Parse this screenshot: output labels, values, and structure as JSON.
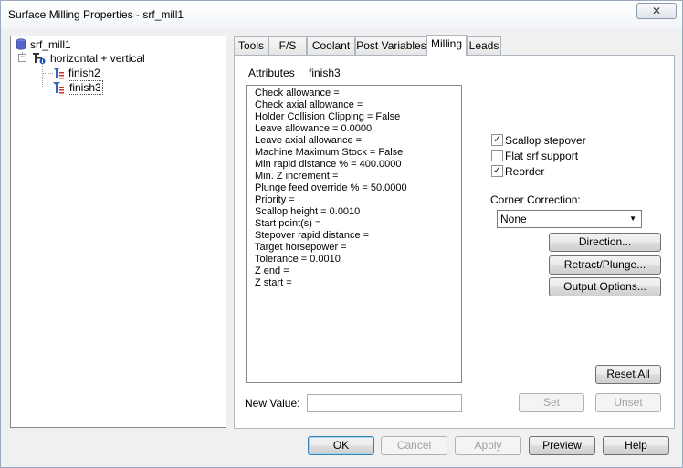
{
  "window": {
    "title": "Surface Milling Properties - srf_mill1",
    "close_label": "✕"
  },
  "tree": {
    "root": "srf_mill1",
    "group": "horizontal + vertical",
    "children": [
      "finish2",
      "finish3"
    ],
    "expander_symbol": "−"
  },
  "tabs": [
    "Tools",
    "F/S",
    "Coolant",
    "Post Variables",
    "Milling",
    "Leads"
  ],
  "active_tab": "Milling",
  "milling": {
    "attributes_label": "Attributes",
    "selected_operation": "finish3",
    "attributes": [
      "Check allowance =",
      "Check axial allowance =",
      "Holder Collision Clipping = False",
      "Leave allowance = 0.0000",
      "Leave axial allowance =",
      "Machine Maximum Stock = False",
      "Min rapid distance % = 400.0000",
      "Min. Z increment =",
      "Plunge feed override % = 50.0000",
      "Priority =",
      "Scallop height = 0.0010",
      "Start point(s) =",
      "Stepover rapid distance =",
      "Target horsepower =",
      "Tolerance = 0.0010",
      "Z end =",
      "Z start ="
    ],
    "checkboxes": [
      {
        "label": "Scallop stepover",
        "checked": true
      },
      {
        "label": "Flat srf support",
        "checked": false
      },
      {
        "label": "Reorder",
        "checked": true
      }
    ],
    "corner_correction_label": "Corner Correction:",
    "corner_correction_value": "None",
    "direction_button": "Direction...",
    "retract_plunge_button": "Retract/Plunge...",
    "output_options_button": "Output Options...",
    "reset_all_button": "Reset All",
    "new_value_label": "New Value:",
    "new_value_value": "",
    "set_button": "Set",
    "unset_button": "Unset"
  },
  "footer": {
    "ok": "OK",
    "cancel": "Cancel",
    "apply": "Apply",
    "preview": "Preview",
    "help": "Help"
  },
  "colors": {
    "tree_icon_blue": "#3b5fc4",
    "tree_icon_red": "#d0302a",
    "selected_red_text": "#d0302a"
  }
}
